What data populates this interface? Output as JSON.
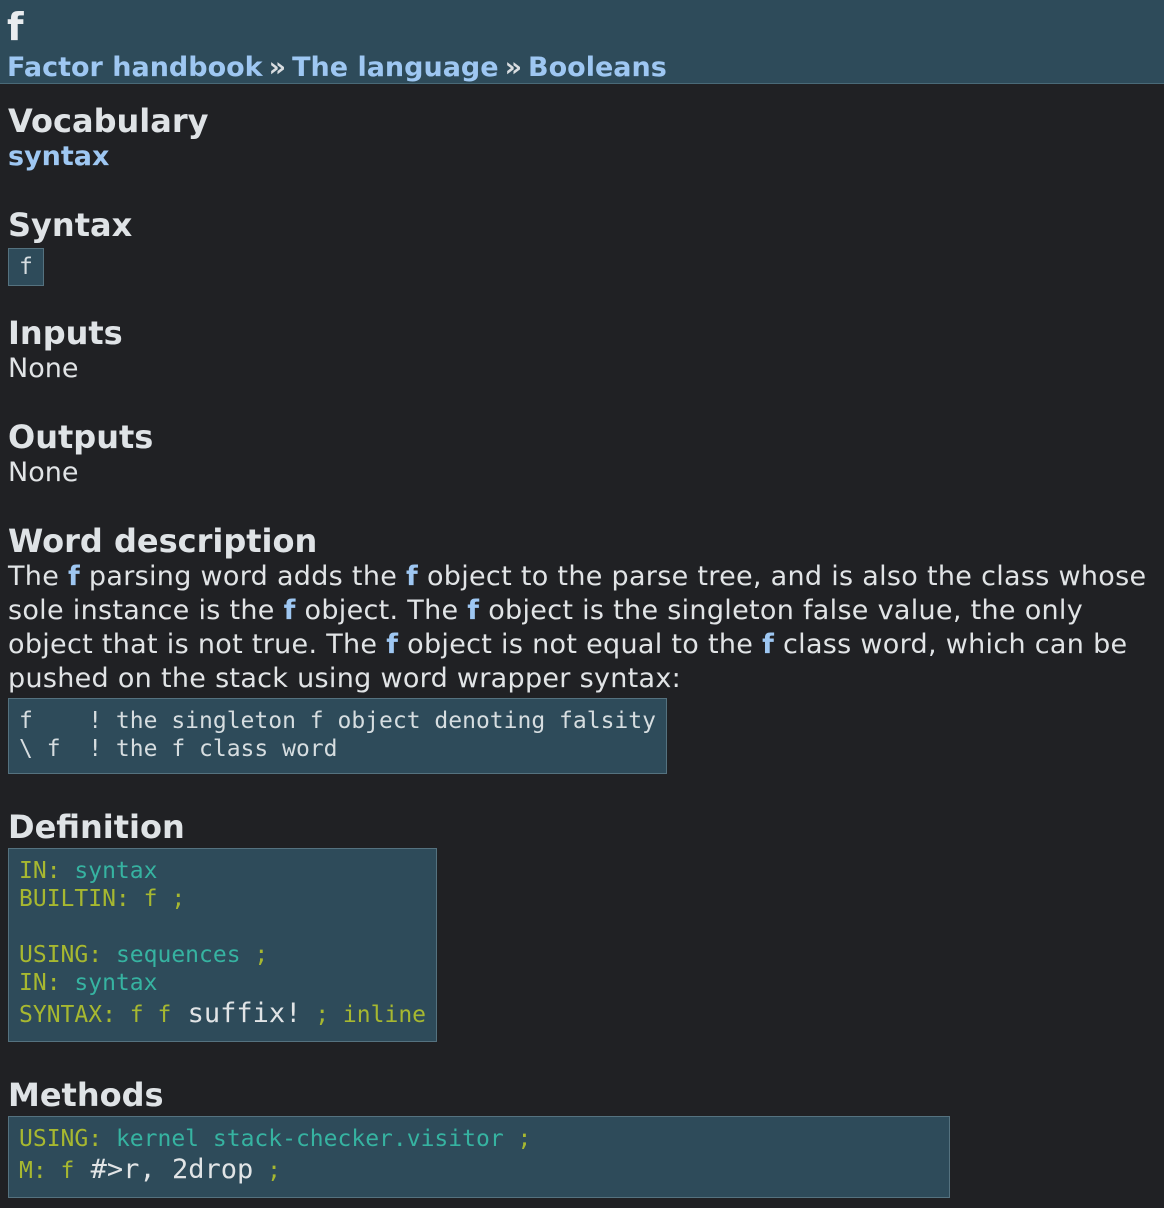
{
  "header": {
    "title": "f",
    "breadcrumb": [
      {
        "label": "Factor handbook"
      },
      {
        "label": "The language"
      },
      {
        "label": "Booleans"
      }
    ],
    "separator": "»"
  },
  "vocabulary": {
    "heading": "Vocabulary",
    "value": "syntax"
  },
  "syntax": {
    "heading": "Syntax",
    "value": "f"
  },
  "inputs": {
    "heading": "Inputs",
    "value": "None"
  },
  "outputs": {
    "heading": "Outputs",
    "value": "None"
  },
  "description": {
    "heading": "Word description",
    "parts": [
      "The ",
      "f",
      " parsing word adds the ",
      "f",
      " object to the parse tree, and is also the class whose sole instance is the ",
      "f",
      " object. The ",
      "f",
      " object is the singleton false value, the only object that is not true. The ",
      "f",
      " object is not equal to the ",
      "f",
      " class word, which can be pushed on the stack using word wrapper syntax:"
    ],
    "code": [
      "f    ! the singleton f object denoting falsity",
      "\\ f  ! the f class word"
    ]
  },
  "definition": {
    "heading": "Definition",
    "lines": [
      {
        "kw": "IN:",
        "rest": [
          {
            "t": " syntax",
            "c": "voc"
          }
        ]
      },
      {
        "kw": "BUILTIN:",
        "rest": [
          {
            "t": " f ;",
            "c": "sym"
          }
        ]
      },
      {
        "kw": "",
        "rest": []
      },
      {
        "kw": "USING:",
        "rest": [
          {
            "t": " sequences",
            "c": "voc"
          },
          {
            "t": " ;",
            "c": "sym"
          }
        ]
      },
      {
        "kw": "IN:",
        "rest": [
          {
            "t": " syntax",
            "c": "voc"
          }
        ]
      },
      {
        "kw": "SYNTAX:",
        "rest": [
          {
            "t": " f f",
            "c": "sym"
          },
          {
            "t": " suffix!",
            "c": "plain"
          },
          {
            "t": " ;",
            "c": "sym"
          },
          {
            "t": " inline",
            "c": "sym"
          }
        ]
      }
    ]
  },
  "methods": {
    "heading": "Methods",
    "lines": [
      {
        "kw": "USING:",
        "rest": [
          {
            "t": " kernel stack-checker.visitor",
            "c": "voc"
          },
          {
            "t": " ;",
            "c": "sym"
          }
        ]
      },
      {
        "kw": "M:",
        "rest": [
          {
            "t": " f",
            "c": "sym"
          },
          {
            "t": " #>r, 2drop",
            "c": "plain"
          },
          {
            "t": " ;",
            "c": "sym"
          }
        ]
      }
    ]
  },
  "colors": {
    "background": "#202124",
    "header_bg": "#2e4b5a",
    "link": "#9ec7f2",
    "keyword": "#a7b830",
    "vocab": "#36b3a1"
  }
}
